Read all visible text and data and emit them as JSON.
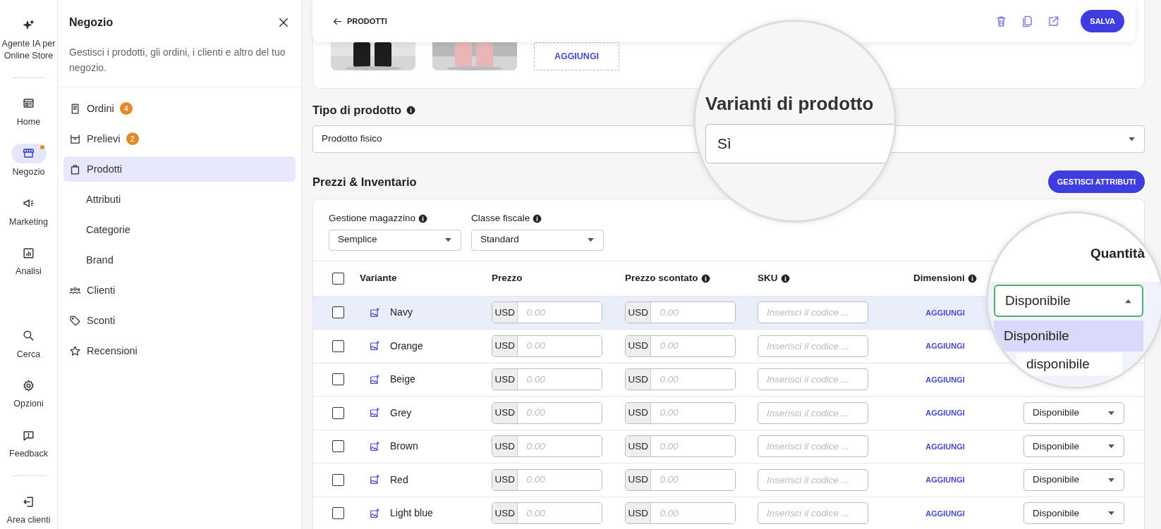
{
  "rail": {
    "items": [
      {
        "label": "Agente IA per Online Store",
        "selected": false,
        "dot": false
      },
      {
        "label": "Home",
        "selected": false,
        "dot": false
      },
      {
        "label": "Negozio",
        "selected": true,
        "dot": true
      },
      {
        "label": "Marketing",
        "selected": false,
        "dot": false
      },
      {
        "label": "Analisi",
        "selected": false,
        "dot": false
      }
    ],
    "bottom_items": [
      {
        "label": "Cerca",
        "selected": false,
        "dot": false
      },
      {
        "label": "Opzioni",
        "selected": false,
        "dot": false
      },
      {
        "label": "Feedback",
        "selected": false,
        "dot": false
      }
    ],
    "footer_item": {
      "label": "Area clienti"
    }
  },
  "panel": {
    "title": "Negozio",
    "description": "Gestisci i prodotti, gli ordini, i clienti e altro del tuo negozio.",
    "items": [
      {
        "label": "Ordini",
        "badge": "4",
        "selected": false
      },
      {
        "label": "Prelievi",
        "badge": "2",
        "selected": false
      },
      {
        "label": "Prodotti",
        "selected": true,
        "children": [
          {
            "label": "Attributi",
            "selected": false
          },
          {
            "label": "Categorie",
            "selected": false
          },
          {
            "label": "Brand",
            "selected": false
          }
        ]
      },
      {
        "label": "Clienti",
        "selected": false
      },
      {
        "label": "Sconti",
        "selected": false
      },
      {
        "label": "Recensioni",
        "selected": false
      }
    ]
  },
  "header": {
    "back_label": "PRODOTTI",
    "save_label": "SALVA"
  },
  "media": {
    "add_label": "AGGIUNGI"
  },
  "product_type": {
    "label": "Tipo di prodotto",
    "info": true,
    "value": "Prodotto fisico"
  },
  "variants_magnifier": {
    "label": "Varianti di prodotto",
    "value": "Sì"
  },
  "pricing": {
    "title": "Prezzi & Inventario",
    "button": "GESTISCI ATTRIBUTI",
    "filters": [
      {
        "label": "Gestione magazzino",
        "info": true,
        "value": "Semplice"
      },
      {
        "label": "Classe fiscale",
        "info": true,
        "value": "Standard"
      }
    ],
    "table": {
      "header_checked": false,
      "columns": [
        {
          "label": "Variante",
          "info": false
        },
        {
          "label": "Prezzo",
          "info": false
        },
        {
          "label": "Prezzo scontato",
          "info": true
        },
        {
          "label": "SKU",
          "info": true
        },
        {
          "label": "Dimensioni",
          "info": true
        }
      ],
      "rows": [
        {
          "name": "Navy",
          "checked": false,
          "selected": true,
          "price_currency": "USD",
          "price_placeholder": "0.00",
          "sale_currency": "USD",
          "sale_placeholder": "0.00",
          "sku_placeholder": "Inserisci il codice ...",
          "dimensions": "AGGIUNGI"
        },
        {
          "name": "Orange",
          "checked": false,
          "selected": false,
          "price_currency": "USD",
          "price_placeholder": "0.00",
          "sale_currency": "USD",
          "sale_placeholder": "0.00",
          "sku_placeholder": "Inserisci il codice ...",
          "dimensions": "AGGIUNGI"
        },
        {
          "name": "Beige",
          "checked": false,
          "selected": false,
          "price_currency": "USD",
          "price_placeholder": "0.00",
          "sale_currency": "USD",
          "sale_placeholder": "0.00",
          "sku_placeholder": "Inserisci il codice ...",
          "dimensions": "AGGIUNGI"
        },
        {
          "name": "Grey",
          "checked": false,
          "selected": false,
          "price_currency": "USD",
          "price_placeholder": "0.00",
          "sale_currency": "USD",
          "sale_placeholder": "0.00",
          "sku_placeholder": "Inserisci il codice ...",
          "dimensions": "AGGIUNGI",
          "quantity": "Disponibile"
        },
        {
          "name": "Brown",
          "checked": false,
          "selected": false,
          "price_currency": "USD",
          "price_placeholder": "0.00",
          "sale_currency": "USD",
          "sale_placeholder": "0.00",
          "sku_placeholder": "Inserisci il codice ...",
          "dimensions": "AGGIUNGI",
          "quantity": "Disponibile"
        },
        {
          "name": "Red",
          "checked": false,
          "selected": false,
          "price_currency": "USD",
          "price_placeholder": "0.00",
          "sale_currency": "USD",
          "sale_placeholder": "0.00",
          "sku_placeholder": "Inserisci il codice ...",
          "dimensions": "AGGIUNGI",
          "quantity": "Disponibile"
        },
        {
          "name": "Light blue",
          "checked": false,
          "selected": false,
          "price_currency": "USD",
          "price_placeholder": "0.00",
          "sale_currency": "USD",
          "sale_placeholder": "0.00",
          "sku_placeholder": "Inserisci il codice ...",
          "dimensions": "AGGIUNGI",
          "quantity": "Disponibile"
        }
      ]
    }
  },
  "quantity_magnifier": {
    "column": "Quantità",
    "value": "Disponibile",
    "open": true,
    "options": [
      {
        "label": "Disponibile",
        "selected": true
      },
      {
        "label": "disponibile",
        "selected": false
      }
    ]
  }
}
